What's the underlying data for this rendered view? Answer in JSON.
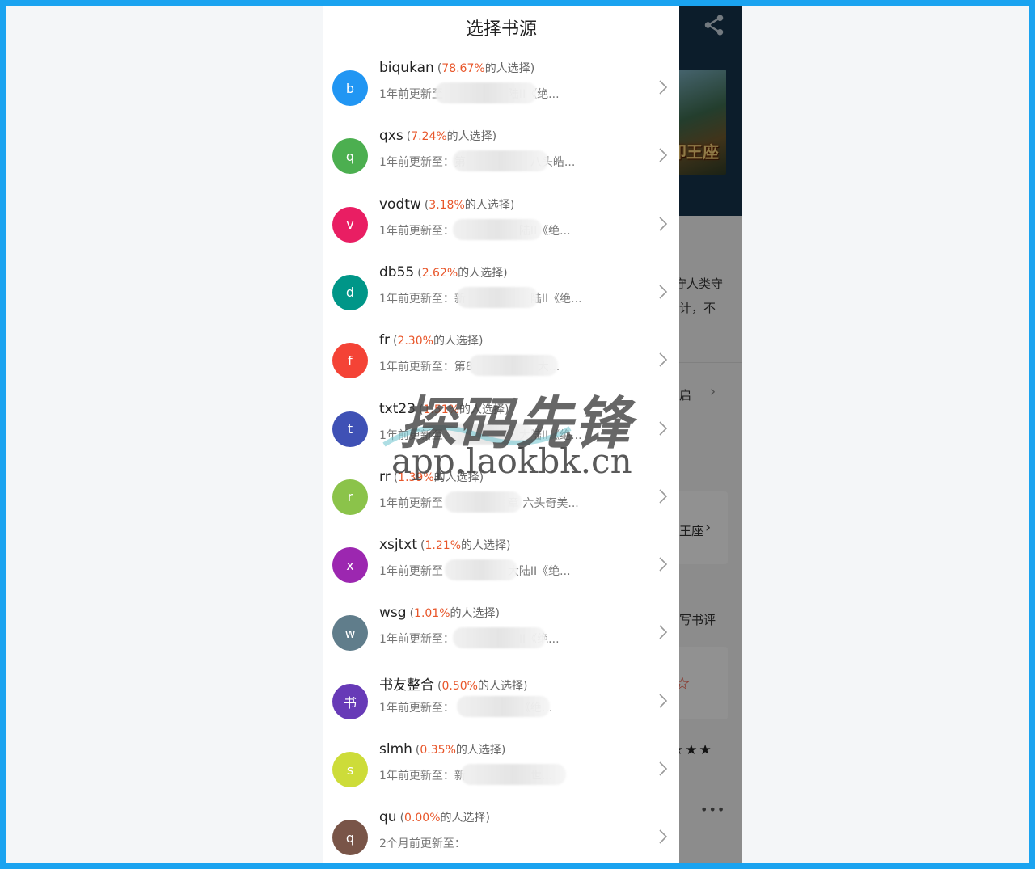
{
  "sheet": {
    "title": "选择书源",
    "pct_suffix": "的人选择",
    "sources": [
      {
        "letter": "b",
        "name": "biqukan",
        "pct": "78.67%",
        "update": "1年前更新至",
        "tail": "陆II《绝...",
        "color": "#2196f3"
      },
      {
        "letter": "q",
        "name": "qxs",
        "pct": "7.24%",
        "update": "1年前更新至：第",
        "tail": "八头皓...",
        "color": "#4caf50"
      },
      {
        "letter": "v",
        "name": "vodtw",
        "pct": "3.18%",
        "update": "1年前更新至：",
        "tail": "陆II《绝...",
        "color": "#e91e63"
      },
      {
        "letter": "d",
        "name": "db55",
        "pct": "2.62%",
        "update": "1年前更新至：新",
        "tail": "陆II《绝...",
        "color": "#009688"
      },
      {
        "letter": "f",
        "name": "fr",
        "pct": "2.30%",
        "update": "1年前更新至：第8",
        "tail": "大...",
        "color": "#f44336"
      },
      {
        "letter": "t",
        "name": "txt23",
        "pct": "1.51%",
        "update": "1年前更新至：",
        "tail": "大陆II《绝...",
        "color": "#3f51b5"
      },
      {
        "letter": "r",
        "name": "rr",
        "pct": "1.39%",
        "update": "1年前更新至",
        "tail": "章 六头奇美...",
        "color": "#8bc34a"
      },
      {
        "letter": "x",
        "name": "xsjtxt",
        "pct": "1.21%",
        "update": "1年前更新至",
        "tail": "大陆II《绝...",
        "color": "#9c27b0"
      },
      {
        "letter": "w",
        "name": "wsg",
        "pct": "1.01%",
        "update": "1年前更新至：",
        "tail": "II《绝...",
        "color": "#607d8b"
      },
      {
        "letter": "书",
        "name": "书友整合",
        "pct": "0.50%",
        "update": "1年前更新至：",
        "tail": "《绝...",
        "color": "#673ab7"
      },
      {
        "letter": "s",
        "name": "slmh",
        "pct": "0.35%",
        "update": "1年前更新至：新",
        "tail": "世...",
        "color": "#cddc39"
      },
      {
        "letter": "q",
        "name": "qu",
        "pct": "0.00%",
        "update": "2个月前更新至：",
        "tail": "",
        "color": "#795548"
      }
    ]
  },
  "background": {
    "cover_title": "印王座",
    "text1": "守人类守",
    "text2": "计，不",
    "text3": "启",
    "text4": "王座",
    "text5": "写书评"
  },
  "watermark": {
    "brand": "探码先锋",
    "url": "app.laokbk.cn"
  },
  "icons": {
    "share": "share-icon",
    "chevron": "chevron-right-icon",
    "star": "star-icon"
  },
  "colors": {
    "frame": "#1aa3f0",
    "percent": "#e8562a",
    "header_dark": "#16334a"
  }
}
